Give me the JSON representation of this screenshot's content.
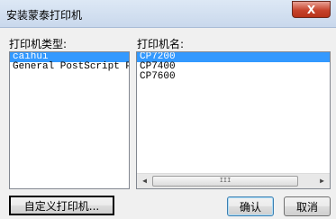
{
  "window": {
    "title": "安装蒙泰打印机",
    "close_label": "X"
  },
  "printer_types": {
    "label": "打印机类型:",
    "items": [
      {
        "label": "caihui",
        "selected": true
      },
      {
        "label": "General PostScript Pr",
        "selected": false
      }
    ]
  },
  "printer_names": {
    "label": "打印机名:",
    "items": [
      {
        "label": "CP7200",
        "selected": true
      },
      {
        "label": "CP7400",
        "selected": false
      },
      {
        "label": "CP7600",
        "selected": false
      }
    ],
    "scrollbar_thumb_label": "III"
  },
  "buttons": {
    "custom_printer": "自定义打印机...",
    "ok": "确认",
    "cancel": "取消"
  },
  "colors": {
    "selection": "#3399ff",
    "close_button": "#c7442d"
  }
}
